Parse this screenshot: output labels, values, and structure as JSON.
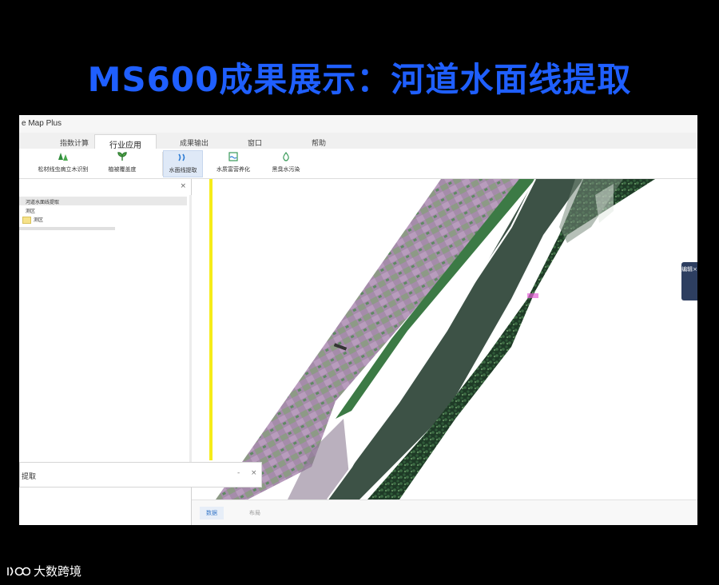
{
  "slide_title": "MS600成果展示：河道水面线提取",
  "app": {
    "title": "e Map Plus",
    "tabs": [
      {
        "label": "指数计算"
      },
      {
        "label": "行业应用"
      },
      {
        "label": "成果输出"
      },
      {
        "label": "窗口"
      },
      {
        "label": "帮助"
      }
    ],
    "active_tab": "行业应用",
    "ribbon_buttons": [
      {
        "label": "松材线虫病立木识别",
        "icon": "tree-icon"
      },
      {
        "label": "植被覆盖度",
        "icon": "leaf-icon"
      },
      {
        "label": "水面线提取",
        "icon": "waterline-icon"
      },
      {
        "label": "水质富营养化",
        "icon": "water-quality-icon"
      },
      {
        "label": "黑臭水污染",
        "icon": "drop-icon"
      }
    ],
    "active_ribbon": "水面线提取",
    "panel_close": "×",
    "tree": {
      "root": "河道水面线提取",
      "child": "测区",
      "folder_label": "测区"
    },
    "float_panel": {
      "title": "提取",
      "minimize": "-",
      "close": "×"
    },
    "side_tab": "编辑×",
    "bottom_tabs": [
      {
        "label": "数据"
      },
      {
        "label": "布局"
      }
    ]
  },
  "watermark": "大数跨境",
  "colors": {
    "title": "#1f5fff",
    "background": "#000000",
    "yellow_bar": "#f6ec19",
    "side_tab": "#2d3e60",
    "river_water": "#3d5246",
    "farmland": "#9b86a0"
  }
}
